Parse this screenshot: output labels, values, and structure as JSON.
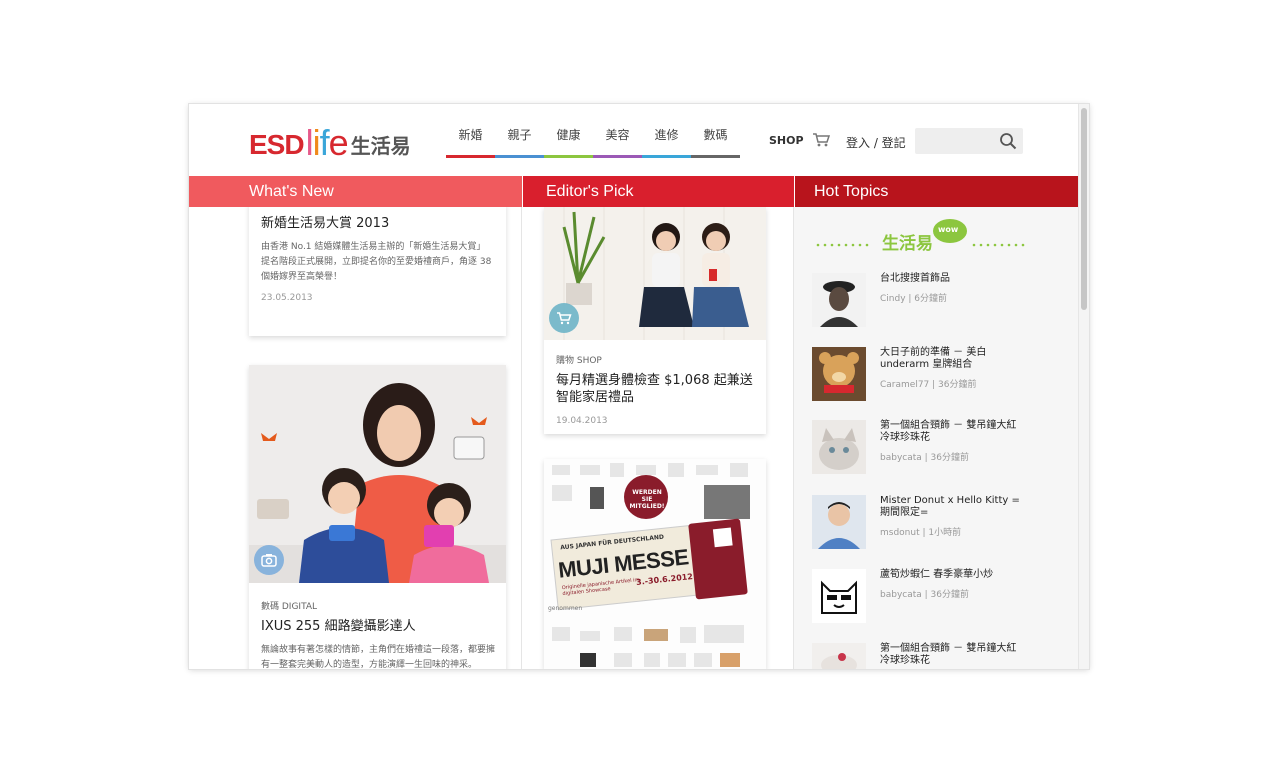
{
  "brand": {
    "logo_esd": "ESD",
    "logo_life": [
      "l",
      "i",
      "f",
      "e"
    ],
    "logo_cn": "生活易"
  },
  "nav": {
    "items": [
      {
        "label": "新婚",
        "color": "#d7282f"
      },
      {
        "label": "親子",
        "color": "#4a90d2"
      },
      {
        "label": "健康",
        "color": "#8cc63f"
      },
      {
        "label": "美容",
        "color": "#9b59b6"
      },
      {
        "label": "進修",
        "color": "#3aa6d9"
      },
      {
        "label": "數碼",
        "color": "#666666"
      }
    ]
  },
  "header": {
    "shop_label": "SHOP",
    "login_label": "登入 / 登記",
    "search_placeholder": ""
  },
  "columns": {
    "whats_new": "What's New",
    "editors_pick": "Editor's Pick",
    "hot_topics": "Hot Topics"
  },
  "whats_new": [
    {
      "title": "新婚生活易大賞  2013",
      "desc": "由香港 No.1 結婚媒體生活易主辦的「新婚生活易大賞」提名階段正式展開，立即提名你的至愛婚禮商戶，角逐 38 個婚嫁界至高榮譽！",
      "date": "23.05.2013"
    },
    {
      "category": "數碼 DIGITAL",
      "title": "IXUS 255 細路變攝影達人",
      "desc": "無論故事有著怎樣的情節，主角們在婚禮這一段落，都要擁有一整套完美動人的造型，方能演繹一生回味的神采。"
    }
  ],
  "editors_pick": [
    {
      "category": "購物 SHOP",
      "title": "每月精選身體檢查  $1,068 起兼送智能家居禮品",
      "date": "19.04.2013"
    },
    {
      "poster_top": "AUS JAPAN FÜR DEUTSCHLAND",
      "poster_main": "MUJI MESSE",
      "poster_sub": "Originelle japanische Artikel im digitalen Showcase",
      "poster_dates": "3.-30.6.2012",
      "poster_badge": "WERDEN SIE MITGLIED!",
      "poster_corner": "genommen"
    }
  ],
  "hot_topics": {
    "wow_label": "生活易",
    "wow_badge": "WOW",
    "items": [
      {
        "title": "台北搜搜首飾品",
        "user": "Cindy",
        "time": "6分鐘前"
      },
      {
        "title": "大日子前的準備 － 美白 underarm 皇牌組合",
        "user": "Caramel77",
        "time": "36分鐘前"
      },
      {
        "title": "第一個組合頸飾 － 雙吊鐘大紅冷球珍珠花",
        "user": "babycata",
        "time": "36分鐘前"
      },
      {
        "title": "Mister Donut x Hello Kitty =期間限定=",
        "user": "msdonut",
        "time": "1小時前"
      },
      {
        "title": "蘆筍炒蝦仁  春季豪華小炒",
        "user": "babycata",
        "time": "36分鐘前"
      },
      {
        "title": "第一個組合頸飾 － 雙吊鐘大紅冷球珍珠花",
        "user": "",
        "time": ""
      }
    ]
  }
}
